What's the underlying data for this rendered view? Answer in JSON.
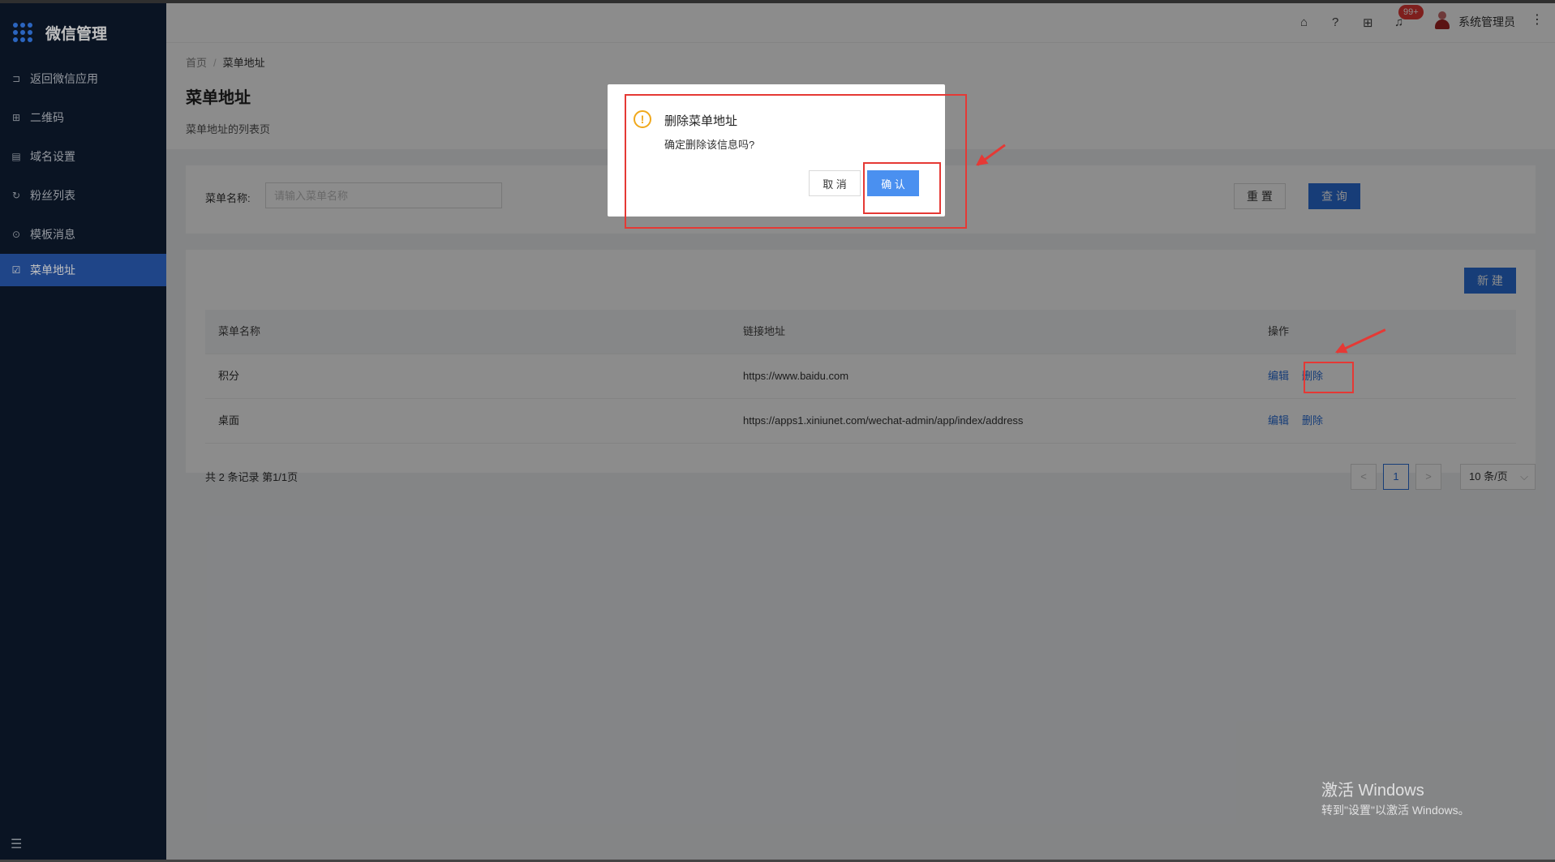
{
  "sidebar": {
    "app_title": "微信管理",
    "items": [
      {
        "icon": "return-icon",
        "glyph": "⊐",
        "label": "返回微信应用"
      },
      {
        "icon": "qrcode-icon",
        "glyph": "⊞",
        "label": "二维码"
      },
      {
        "icon": "document-icon",
        "glyph": "▤",
        "label": "域名设置"
      },
      {
        "icon": "refresh-icon",
        "glyph": "↻",
        "label": "粉丝列表"
      },
      {
        "icon": "chat-icon",
        "glyph": "⊙",
        "label": "模板消息"
      },
      {
        "icon": "checklist-icon",
        "glyph": "☑",
        "label": "菜单地址"
      }
    ],
    "active_index": 5
  },
  "header": {
    "notification_badge": "99+",
    "username": "系统管理员"
  },
  "breadcrumb": {
    "home": "首页",
    "sep": "/",
    "current": "菜单地址"
  },
  "page": {
    "title": "菜单地址",
    "description": "菜单地址的列表页"
  },
  "search": {
    "label": "菜单名称:",
    "placeholder": "请输入菜单名称",
    "reset_label": "重 置",
    "query_label": "查 询"
  },
  "table": {
    "new_label": "新 建",
    "columns": [
      "菜单名称",
      "链接地址",
      "操作"
    ],
    "rows": [
      {
        "name": "积分",
        "url": "https://www.baidu.com",
        "edit": "编辑",
        "delete": "删除"
      },
      {
        "name": "桌面",
        "url": "https://apps1.xiniunet.com/wechat-admin/app/index/address",
        "edit": "编辑",
        "delete": "删除"
      }
    ],
    "total_text": "共 2 条记录 第1/1页"
  },
  "pagination": {
    "prev": "<",
    "current": "1",
    "next": ">",
    "page_size": "10 条/页"
  },
  "dialog": {
    "title": "删除菜单地址",
    "content": "确定删除该信息吗?",
    "cancel_label": "取 消",
    "confirm_label": "确 认"
  },
  "watermark": {
    "line1": "激活 Windows",
    "line2": "转到\"设置\"以激活 Windows。"
  },
  "colors": {
    "sidebar_bg": "#0e1b2f",
    "accent": "#2a6fdb",
    "annotation": "#e53935",
    "warning": "#f0a81c"
  }
}
